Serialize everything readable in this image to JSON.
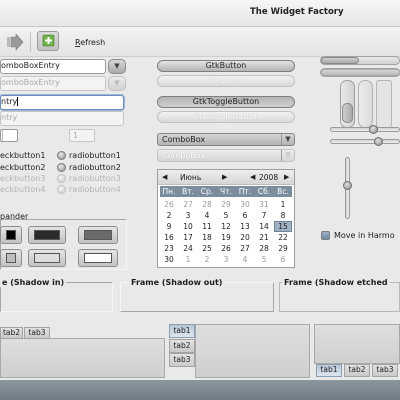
{
  "window": {
    "title": "The Widget Factory"
  },
  "toolbar": {
    "refresh_label": "Refresh"
  },
  "entries": {
    "combo_entry_1": "omboBoxEntry",
    "combo_entry_2": "omboBoxEntry",
    "entry_focused": "ntry",
    "entry_disabled": "ntry"
  },
  "spinbuttons": {
    "spin_1": "",
    "spin_2": "1"
  },
  "checkbuttons": [
    "eckbutton1",
    "eckbutton2",
    "eckbutton3",
    "eckbutton4"
  ],
  "radiobuttons": [
    "radiobutton1",
    "radiobutton2",
    "radiobutton3",
    "radiobutton4"
  ],
  "expander": {
    "label": "pander"
  },
  "colors": {
    "swatch_1": "#000000",
    "swatch_2": "#2a2a2a",
    "swatch_3": "#6a6a6a",
    "swatch_4": "#bdbdbd",
    "swatch_5": "#dedede",
    "swatch_6": "#ffffff",
    "accent": "#7c8e9e"
  },
  "buttons": {
    "gtk_button": "GtkButton",
    "gtk_button_disabled": "GtkButton",
    "toggle_button": "GtkToggleButton",
    "toggle_button_disabled": "GtkToggleButton"
  },
  "combos": {
    "combo_1": "ComboBox",
    "combo_2": "ComboBox"
  },
  "calendar": {
    "month": "Июнь",
    "year": "2008",
    "weekdays": [
      "Пн.",
      "Вт.",
      "Ср.",
      "Чт.",
      "Пт.",
      "Сб.",
      "Вс."
    ],
    "rows": [
      [
        "26",
        "27",
        "28",
        "29",
        "30",
        "31",
        "1"
      ],
      [
        "2",
        "3",
        "4",
        "5",
        "6",
        "7",
        "8"
      ],
      [
        "9",
        "10",
        "11",
        "12",
        "13",
        "14",
        "15"
      ],
      [
        "16",
        "17",
        "18",
        "19",
        "20",
        "21",
        "22"
      ],
      [
        "23",
        "24",
        "25",
        "26",
        "27",
        "28",
        "29"
      ],
      [
        "30",
        "1",
        "2",
        "3",
        "4",
        "5",
        "6"
      ]
    ],
    "selected_day": "15"
  },
  "check_harmony": {
    "label": "Move in Harmo"
  },
  "frames": {
    "shadow_in": "e (Shadow in)",
    "shadow_out": "Frame (Shadow out)",
    "shadow_etched": "Frame (Shadow etched"
  },
  "notebooks": {
    "top": [
      "tab2",
      "tab3"
    ],
    "left": [
      "tab1",
      "tab2",
      "tab3"
    ],
    "bottom": [
      "tab1",
      "tab2",
      "tab3"
    ]
  },
  "icons": {
    "back": "arrow-right-icon",
    "add": "add-icon"
  }
}
